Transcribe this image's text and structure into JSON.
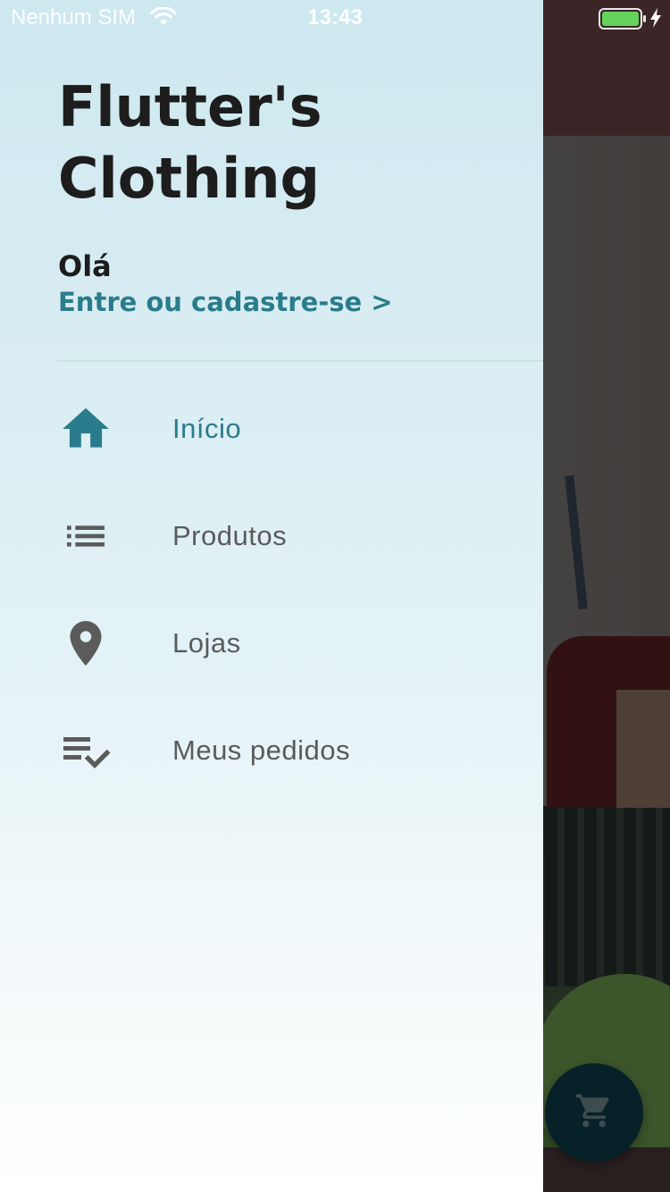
{
  "status_bar": {
    "carrier": "Nenhum SIM",
    "time": "13:43",
    "wifi_icon": "wifi-icon",
    "battery_icon": "battery-charging-icon"
  },
  "drawer": {
    "title": "Flutter's Clothing",
    "greeting": "Olá",
    "login_link": "Entre ou cadastre-se >",
    "items": [
      {
        "label": "Início",
        "icon": "home-icon",
        "active": true
      },
      {
        "label": "Produtos",
        "icon": "list-icon",
        "active": false
      },
      {
        "label": "Lojas",
        "icon": "location-pin-icon",
        "active": false
      },
      {
        "label": "Meus pedidos",
        "icon": "playlist-check-icon",
        "active": false
      }
    ]
  },
  "fab": {
    "icon": "shopping-cart-icon"
  },
  "colors": {
    "accent": "#2a7c8c",
    "title_text": "#1d1d1d",
    "inactive_text": "#5b5b5b",
    "fab_background": "#0c3c48"
  }
}
